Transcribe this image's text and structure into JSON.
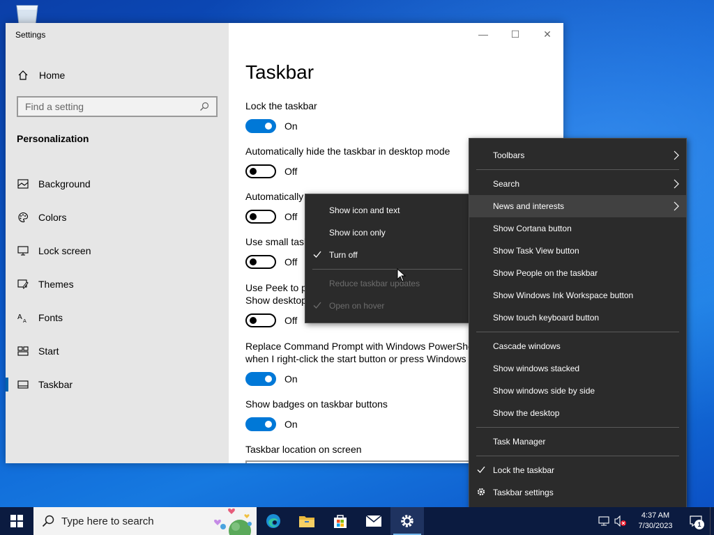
{
  "settings": {
    "window_title": "Settings",
    "home_label": "Home",
    "search_placeholder": "Find a setting",
    "section_header": "Personalization",
    "nav_items": [
      {
        "label": "Background",
        "icon": "image-icon"
      },
      {
        "label": "Colors",
        "icon": "palette-icon"
      },
      {
        "label": "Lock screen",
        "icon": "monitor-icon"
      },
      {
        "label": "Themes",
        "icon": "brush-icon"
      },
      {
        "label": "Fonts",
        "icon": "font-icon"
      },
      {
        "label": "Start",
        "icon": "start-grid-icon"
      },
      {
        "label": "Taskbar",
        "icon": "taskbar-icon",
        "active": true
      }
    ],
    "window_controls": {
      "minimize": "—",
      "maximize": "☐",
      "close": "✕"
    },
    "page_title": "Taskbar",
    "settings_list": [
      {
        "label": "Lock the taskbar",
        "state": "On"
      },
      {
        "label": "Automatically hide the taskbar in desktop mode",
        "state": "Off"
      },
      {
        "label": "Automatically",
        "state": "Off"
      },
      {
        "label": "Use small task",
        "state": "Off"
      },
      {
        "label_line1": "Use Peek to p",
        "label_line2": "Show desktop",
        "state": "Off"
      },
      {
        "label_line1": "Replace Command Prompt with Windows PowerShe",
        "label_line2": "when I right-click the start button or press Windows",
        "state": "On"
      },
      {
        "label": "Show badges on taskbar buttons",
        "state": "On"
      }
    ],
    "location_label": "Taskbar location on screen"
  },
  "context_menu": {
    "items": [
      {
        "label": "Toolbars",
        "submenu": true
      },
      {
        "separator": true
      },
      {
        "label": "Search",
        "submenu": true
      },
      {
        "label": "News and interests",
        "submenu": true,
        "hover": true
      },
      {
        "label": "Show Cortana button"
      },
      {
        "label": "Show Task View button"
      },
      {
        "label": "Show People on the taskbar"
      },
      {
        "label": "Show Windows Ink Workspace button"
      },
      {
        "label": "Show touch keyboard button"
      },
      {
        "separator": true
      },
      {
        "label": "Cascade windows"
      },
      {
        "label": "Show windows stacked"
      },
      {
        "label": "Show windows side by side"
      },
      {
        "label": "Show the desktop"
      },
      {
        "separator": true
      },
      {
        "label": "Task Manager"
      },
      {
        "separator": true
      },
      {
        "label": "Lock the taskbar",
        "checked": true
      },
      {
        "label": "Taskbar settings",
        "gear": true
      }
    ]
  },
  "news_submenu": {
    "items": [
      {
        "label": "Show icon and text"
      },
      {
        "label": "Show icon only"
      },
      {
        "label": "Turn off",
        "checked": true
      },
      {
        "separator": true
      },
      {
        "label": "Reduce taskbar updates",
        "disabled": true
      },
      {
        "label": "Open on hover",
        "disabled": true,
        "checked": true
      }
    ]
  },
  "taskbar": {
    "search_placeholder": "Type here to search",
    "apps": [
      "edge-icon",
      "file-explorer-icon",
      "store-icon",
      "mail-icon",
      "settings-gear-icon"
    ],
    "clock_time": "4:37 AM",
    "clock_date": "7/30/2023",
    "notification_count": "1"
  },
  "colors": {
    "accent": "#0078d7",
    "menu_bg": "#2b2b2b",
    "taskbar_bg": "#0b1b40"
  }
}
